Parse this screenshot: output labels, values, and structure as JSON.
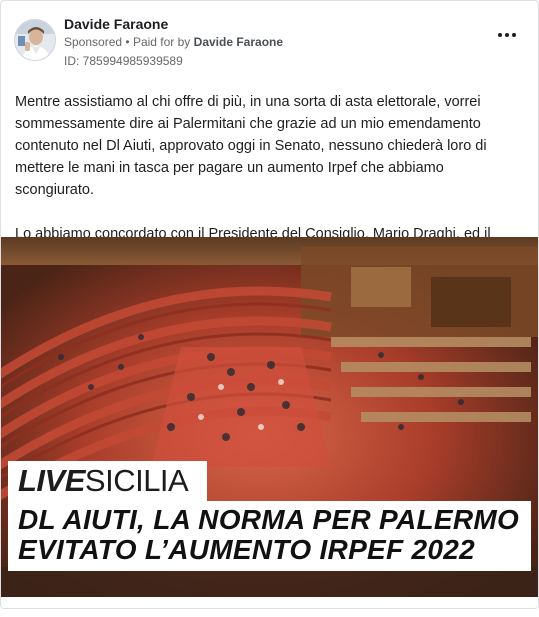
{
  "post": {
    "author": "Davide Faraone",
    "sponsored_label": "Sponsored",
    "separator": "•",
    "paid_for_prefix": "Paid for by",
    "paid_for_name": "Davide Faraone",
    "ad_id": "ID: 785994985939589",
    "more_icon": "more-horizontal-icon",
    "paragraph1": "Mentre assistiamo al chi offre di più, in una sorta di asta elettorale, vorrei sommessamente dire ai Palermitani che grazie ad un mio emendamento contenuto nel Dl Aiuti, approvato oggi in Senato, nessuno chiederà loro di mettere le mani in tasca per pagare un aumento Irpef che abbiamo scongiurato.",
    "paragraph2": "Lo abbiamo concordato con il Presidente del Consiglio, Mario Draghi, ed il sindaco di Palermo, Roberto Lagalla, perché famiglie ed imprese sono già abbastanza…"
  },
  "media": {
    "logo_live": "LIVE",
    "logo_sicilia": "SICILIA",
    "headline_line1": "DL AIUTI, LA NORMA PER PALERMO",
    "headline_line2": "EVITATO L’AUMENTO IRPEF 2022"
  },
  "colors": {
    "text_primary": "#1c1e21",
    "text_secondary": "#65676b",
    "card_border": "#dddfe2"
  }
}
